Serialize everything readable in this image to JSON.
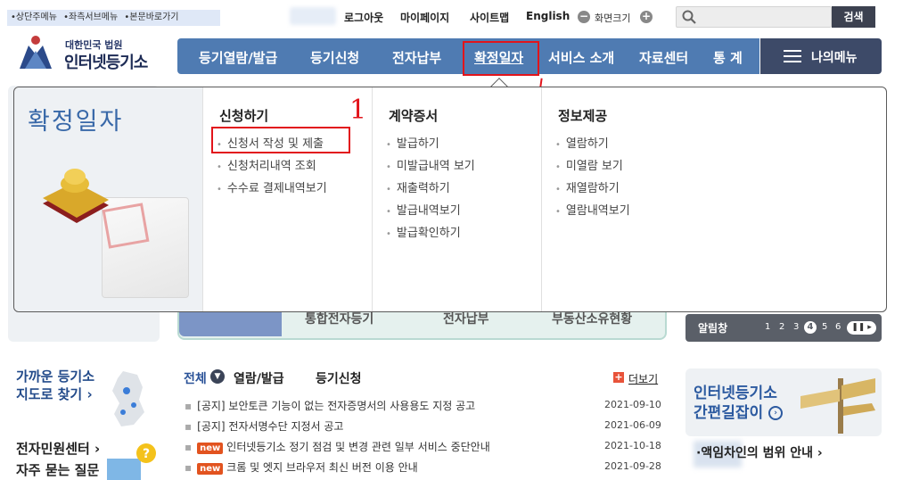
{
  "skip_links": [
    "•상단주메뉴",
    "•좌측서브메뉴",
    "•본문바로가기"
  ],
  "utility": {
    "logout": "로그아웃",
    "mypage": "마이페이지",
    "sitemap": "사이트맵",
    "english": "English",
    "zoom_minus": "−",
    "zoom_label": "화면크기",
    "zoom_plus": "+",
    "search_button": "검색"
  },
  "logo": {
    "sub": "대한민국 법원",
    "main": "인터넷등기소"
  },
  "nav": {
    "items": [
      "등기열람/발급",
      "등기신청",
      "전자납부",
      "확정일자",
      "서비스 소개",
      "자료센터",
      "통 계"
    ],
    "my_menu": "나의메뉴",
    "active": "확정일자"
  },
  "dropdown": {
    "title": "확정일자",
    "columns": [
      {
        "title": "신청하기",
        "items": [
          "신청서 작성 및 제출",
          "신청처리내역 조회",
          "수수료 결제내역보기"
        ]
      },
      {
        "title": "계약증서",
        "items": [
          "발급하기",
          "미발급내역 보기",
          "재출력하기",
          "발급내역보기",
          "발급확인하기"
        ]
      },
      {
        "title": "정보제공",
        "items": [
          "열람하기",
          "미열람 보기",
          "재열람하기",
          "열람내역보기"
        ]
      }
    ],
    "annotation": "1"
  },
  "quick_bar": [
    "통합전자등기",
    "전자납부",
    "부동산소유현황"
  ],
  "alarm": {
    "label": "알림창",
    "pages": [
      "1",
      "2",
      "3",
      "4",
      "5",
      "6"
    ],
    "current": "4",
    "pause": "❚❚ ▸"
  },
  "sidebar_links": {
    "find_registry_line1": "가까운 등기소",
    "find_registry_line2": "지도로 찾기 ›",
    "civil_center": "전자민원센터 ›",
    "faq": "자주 묻는 질문"
  },
  "notice_tabs": {
    "all": "전체",
    "view_issue": "열람/발급",
    "apply": "등기신청",
    "more": "더보기",
    "more_plus": "+"
  },
  "notices": [
    {
      "badge": "",
      "title": "[공지] 보안토큰 기능이 없는 전자증명서의 사용용도 지정 공고",
      "date": "2021-09-10"
    },
    {
      "badge": "",
      "title": "[공지] 전자서명수단 지정서 공고",
      "date": "2021-06-09"
    },
    {
      "badge": "new",
      "title": "인터넷등기소 정기 점검 및 변경 관련 일부 서비스 중단안내",
      "date": "2021-10-18"
    },
    {
      "badge": "new",
      "title": "크롬 및 엣지 브라우저 최신 버전 이용 안내",
      "date": "2021-09-28"
    }
  ],
  "easy_guide": {
    "line1": "인터넷등기소",
    "line2": "간편길잡이",
    "go": "›"
  },
  "scope": "∙액임차인의 범위 안내  ›",
  "colors": {
    "nav_blue": "#4f7bb2",
    "my_menu_dark": "#3d4a68",
    "annotation_red": "#e2141b",
    "title_blue": "#3868a8"
  }
}
